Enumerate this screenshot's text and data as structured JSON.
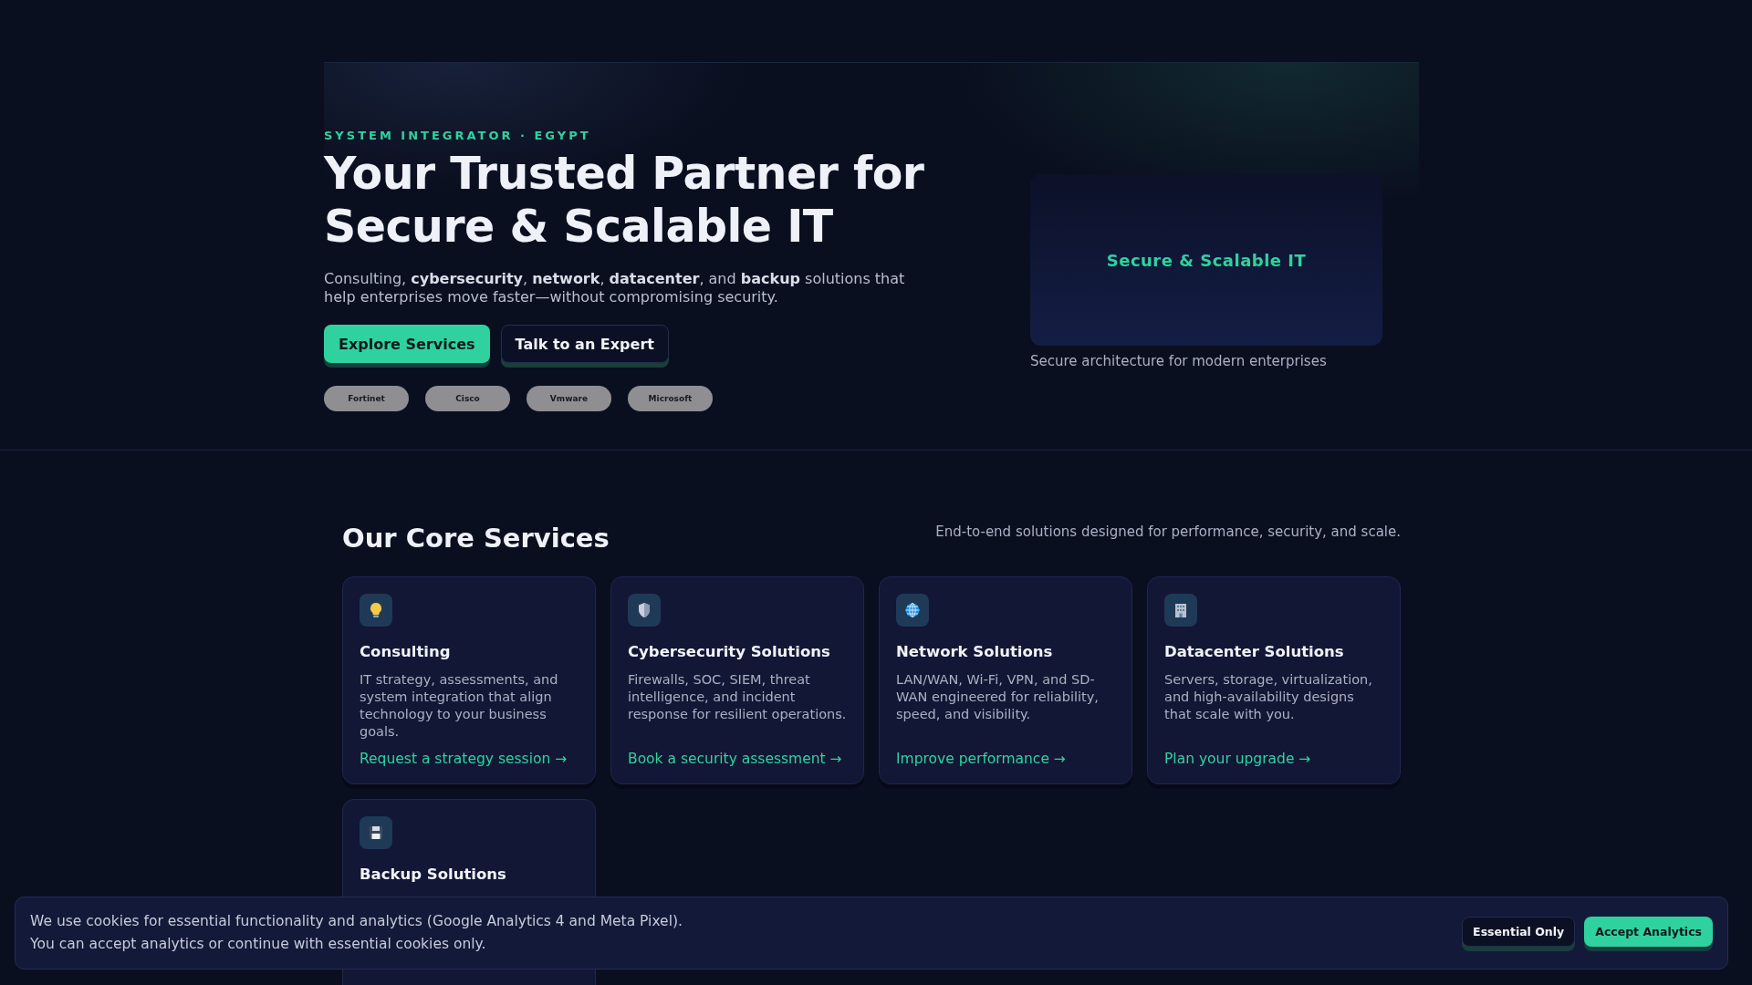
{
  "hero": {
    "eyebrow": "SYSTEM INTEGRATOR · EGYPT",
    "title_lines": [
      "Your Trusted Partner for",
      "Secure & Scalable IT"
    ],
    "description": "Consulting, **cybersecurity**, **network**, **datacenter**, and **backup** solutions that help enterprises move faster—without compromising security.",
    "buttons": [
      {
        "label": "Explore Services",
        "kind": "primary"
      },
      {
        "label": "Talk to an Expert",
        "kind": "secondary"
      }
    ],
    "partners": [
      "Fortinet",
      "Cisco",
      "Vmware",
      "Microsoft"
    ],
    "visual": {
      "label": "Secure & Scalable IT",
      "caption": "Secure architecture for modern enterprises"
    }
  },
  "services": {
    "title": "Our Core Services",
    "subtitle": "End-to-end solutions designed for performance, security, and scale.",
    "cards": [
      {
        "title": "Consulting",
        "description": "IT strategy, assessments, and system integration that align technology to your business goals.",
        "link": "Request a strategy session →"
      },
      {
        "title": "Cybersecurity Solutions",
        "description": "Firewalls, SOC, SIEM, threat intelligence, and incident response for resilient operations.",
        "link": "Book a security assessment →"
      },
      {
        "title": "Network Solutions",
        "description": "LAN/WAN, Wi-Fi, VPN, and SD-WAN engineered for reliability, speed, and visibility.",
        "link": "Improve performance →"
      },
      {
        "title": "Datacenter Solutions",
        "description": "Servers, storage, virtualization, and high-availability designs that scale with you.",
        "link": "Plan your upgrade →"
      },
      {
        "title": "Backup Solutions"
      }
    ]
  },
  "cookie_banner": {
    "lines": [
      "We use cookies for essential functionality and analytics (Google Analytics 4 and Meta Pixel).",
      "You can accept analytics or continue with essential cookies only."
    ],
    "buttons": [
      {
        "label": "Essential Only",
        "kind": "secondary"
      },
      {
        "label": "Accept Analytics",
        "kind": "primary"
      }
    ]
  }
}
